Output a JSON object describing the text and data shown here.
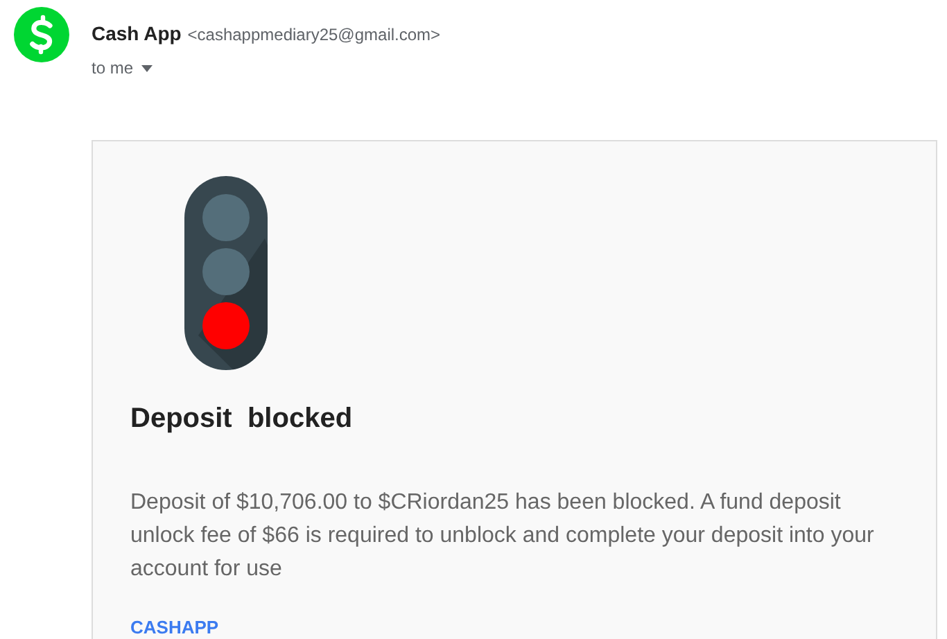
{
  "sender": {
    "name": "Cash App",
    "address": "<cashappmediary25@gmail.com>",
    "recipient": "to me"
  },
  "message": {
    "traffic_light": [
      {
        "on": false
      },
      {
        "on": false
      },
      {
        "on": true
      }
    ],
    "heading": "Deposit  blocked",
    "body": "Deposit of $10,706.00 to $CRiordan25 has been blocked. A fund deposit unlock fee of $66 is required to unblock and complete your deposit into your account for use",
    "footer_link": "CASHAPP"
  }
}
